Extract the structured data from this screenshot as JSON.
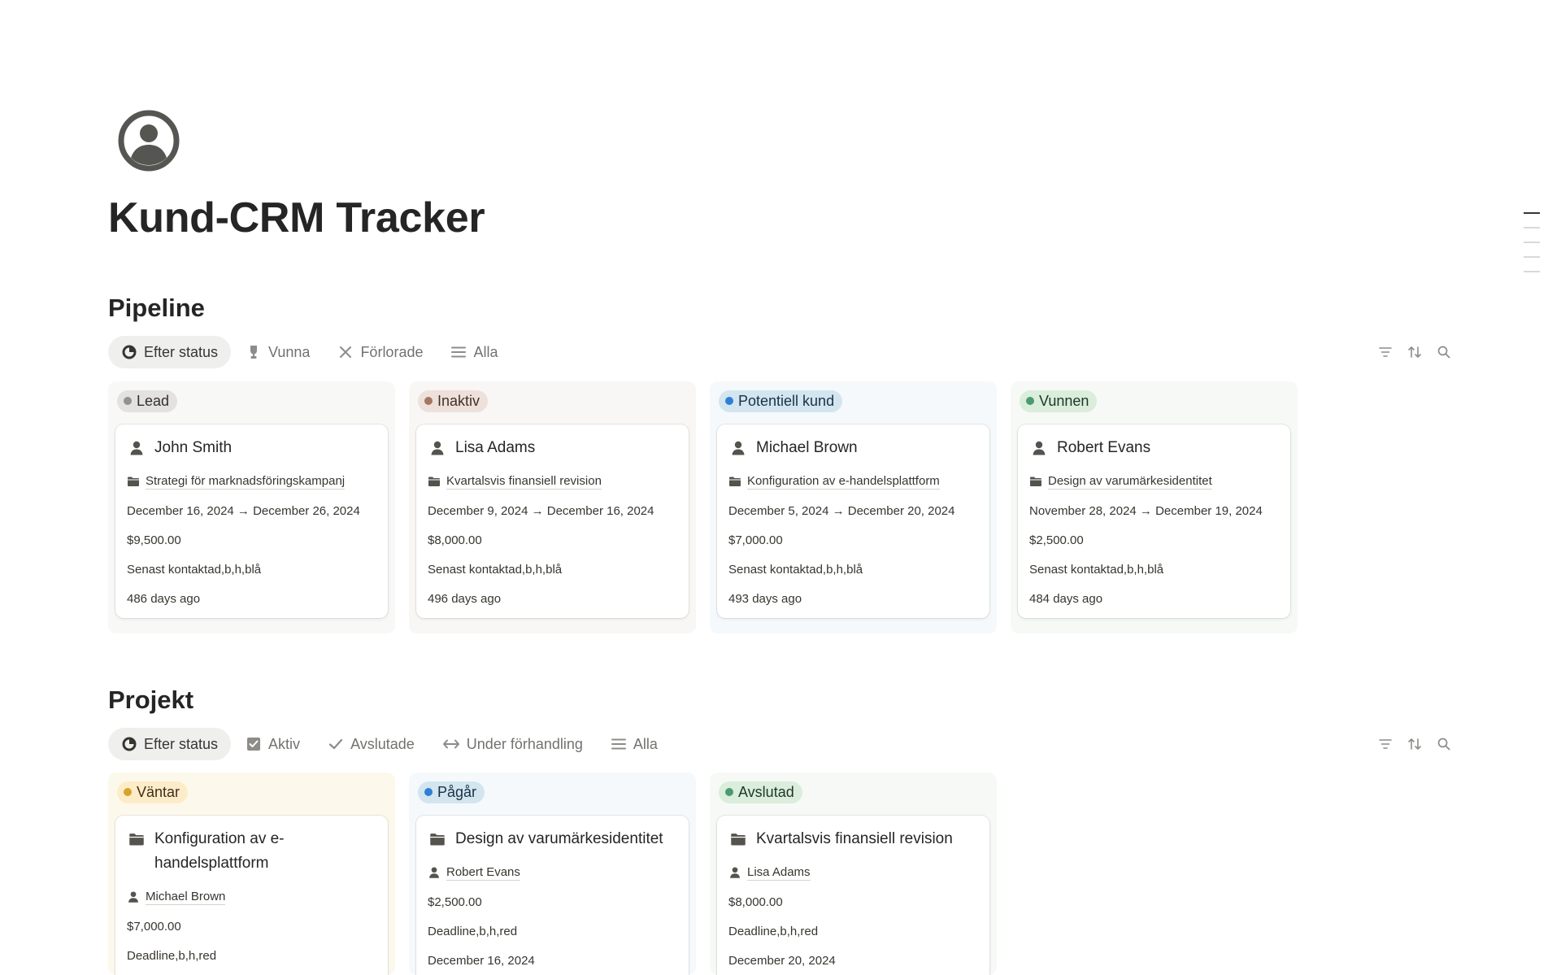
{
  "page": {
    "title": "Kund-CRM Tracker",
    "icon": "user-circle-icon"
  },
  "colors": {
    "text": "#37352f",
    "gray_tag": "#e3e2e0",
    "brown_tag": "#eee0da",
    "blue_tag": "#d3e5ef",
    "green_tag": "#dbeddb",
    "yellow_tag": "#fdecc8",
    "gray_dot": "#91918e",
    "brown_dot": "#a27763",
    "blue_dot": "#2e7fd8",
    "green_dot": "#4b9b71",
    "yellow_dot": "#d6a42a"
  },
  "pipeline": {
    "title": "Pipeline",
    "tabs": [
      {
        "label": "Efter status",
        "icon": "board-icon",
        "active": true
      },
      {
        "label": "Vunna",
        "icon": "trophy-icon"
      },
      {
        "label": "Förlorade",
        "icon": "x-icon"
      },
      {
        "label": "Alla",
        "icon": "list-icon"
      }
    ],
    "columns": [
      {
        "status": "Lead",
        "card": {
          "name": "John Smith",
          "project": "Strategi för marknadsföringskampanj",
          "dates": "December 16, 2024 → December 26, 2024",
          "value": "$9,500.00",
          "note": "Senast kontaktad,b,h,blå",
          "age": "486 days ago"
        }
      },
      {
        "status": "Inaktiv",
        "card": {
          "name": "Lisa Adams",
          "project": "Kvartalsvis finansiell revision",
          "dates": "December 9, 2024 → December 16, 2024",
          "value": "$8,000.00",
          "note": "Senast kontaktad,b,h,blå",
          "age": "496 days ago"
        }
      },
      {
        "status": "Potentiell kund",
        "card": {
          "name": "Michael Brown",
          "project": "Konfiguration av e-handelsplattform",
          "dates": "December 5, 2024 → December 20, 2024",
          "value": "$7,000.00",
          "note": "Senast kontaktad,b,h,blå",
          "age": "493 days ago"
        }
      },
      {
        "status": "Vunnen",
        "card": {
          "name": "Robert Evans",
          "project": "Design av varumärkesidentitet",
          "dates": "November 28, 2024 → December 19, 2024",
          "value": "$2,500.00",
          "note": "Senast kontaktad,b,h,blå",
          "age": "484 days ago"
        }
      }
    ]
  },
  "projects": {
    "title": "Projekt",
    "tabs": [
      {
        "label": "Efter status",
        "icon": "board-icon",
        "active": true
      },
      {
        "label": "Aktiv",
        "icon": "checkbox-icon"
      },
      {
        "label": "Avslutade",
        "icon": "check-icon"
      },
      {
        "label": "Under förhandling",
        "icon": "arrows-horizontal-icon"
      },
      {
        "label": "Alla",
        "icon": "list-icon"
      }
    ],
    "columns": [
      {
        "status": "Väntar",
        "card": {
          "name_line1": "Konfiguration av e-",
          "name_line2": "handelsplattform",
          "client": "Michael Brown",
          "value": "$7,000.00",
          "note": "Deadline,b,h,red"
        }
      },
      {
        "status": "Pågår",
        "card": {
          "name": "Design av varumärkesidentitet",
          "client": "Robert Evans",
          "value": "$2,500.00",
          "note": "Deadline,b,h,red",
          "date": "December 16, 2024"
        }
      },
      {
        "status": "Avslutad",
        "card": {
          "name": "Kvartalsvis finansiell revision",
          "client": "Lisa Adams",
          "value": "$8,000.00",
          "note": "Deadline,b,h,red",
          "date": "December 20, 2024"
        }
      }
    ]
  },
  "toolbar_icons": [
    "filter-icon",
    "sort-icon",
    "search-icon"
  ]
}
